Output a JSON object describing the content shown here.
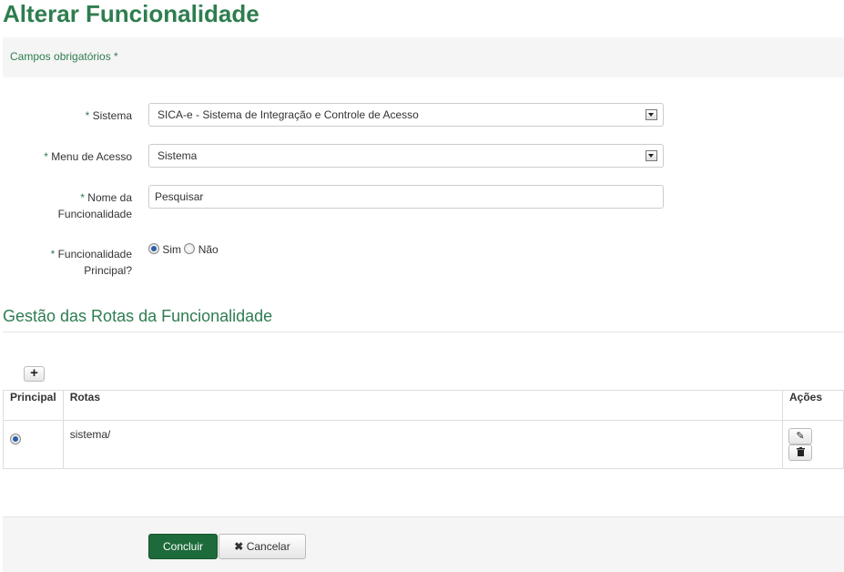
{
  "page": {
    "title": "Alterar Funcionalidade"
  },
  "notice": {
    "required_fields": "Campos obrigatórios *"
  },
  "form": {
    "required_mark": "*",
    "sistema": {
      "label": "Sistema",
      "value": "SICA-e - Sistema de Integração e Controle de Acesso"
    },
    "menu": {
      "label": "Menu de Acesso",
      "value": "Sistema"
    },
    "nome": {
      "label_line1": "Nome da",
      "label_line2": "Funcionalidade",
      "value": "Pesquisar"
    },
    "principal": {
      "label_line1": "Funcionalidade",
      "label_line2": "Principal?",
      "option_yes": "Sim",
      "option_no": "Não",
      "selected": "Sim"
    }
  },
  "routes": {
    "section_title": "Gestão das Rotas da Funcionalidade",
    "add_icon": "plus-icon",
    "columns": [
      "Principal",
      "Rotas",
      "Ações"
    ],
    "rows": [
      {
        "principal": true,
        "rota": "sistema/"
      }
    ],
    "row_action_icons": [
      "pencil-icon",
      "trash-icon"
    ]
  },
  "footer": {
    "confirm_label": "Concluir",
    "cancel_label": "Cancelar",
    "cancel_icon": "close-icon"
  },
  "colors": {
    "accent": "#2e7d4f",
    "primary_button": "#1d6b3a"
  }
}
